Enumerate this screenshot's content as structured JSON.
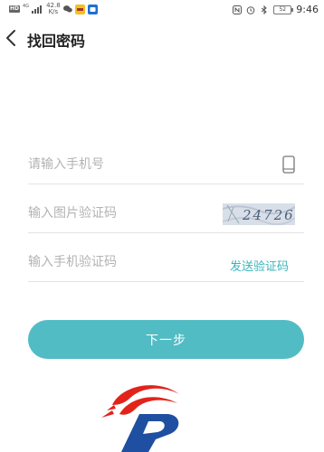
{
  "status_bar": {
    "network_badge": "HD",
    "network_type": "4G",
    "speed_value": "42.8",
    "speed_unit": "K/s",
    "battery": "52",
    "time": "9:46"
  },
  "header": {
    "title": "找回密码"
  },
  "form": {
    "phone_placeholder": "请输入手机号",
    "captcha_placeholder": "输入图片验证码",
    "sms_placeholder": "输入手机验证码",
    "send_code_label": "发送验证码",
    "captcha_text": "24726",
    "next_label": "下一步"
  },
  "colors": {
    "accent": "#52bcc4",
    "link": "#3cb3bb",
    "logo_red": "#e2231a",
    "logo_blue": "#1f4fa0"
  }
}
